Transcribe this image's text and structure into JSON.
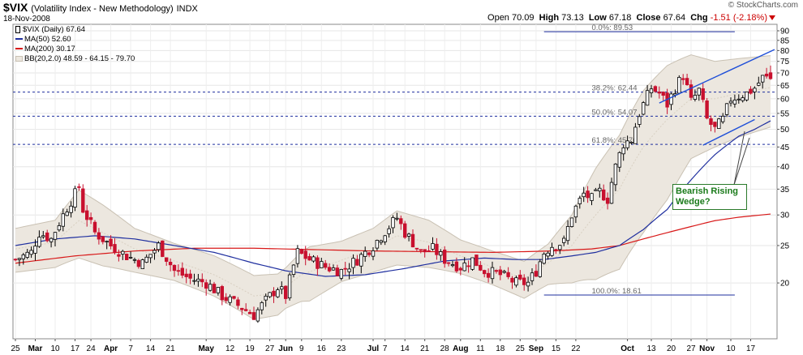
{
  "header": {
    "symbol": "$VIX",
    "description": "(Volatility Index - New Methodology)",
    "exchange": "INDX",
    "date": "18-Nov-2008",
    "credit": "© StockCharts.com",
    "open_label": "Open",
    "open": "70.09",
    "high_label": "High",
    "high": "73.13",
    "low_label": "Low",
    "low": "67.18",
    "close_label": "Close",
    "close": "67.64",
    "chg_label": "Chg",
    "chg": "-1.51 (-2.18%)"
  },
  "legend": {
    "price": "$VIX (Daily) 67.64",
    "ma50": "MA(50) 52.60",
    "ma200": "MA(200) 30.17",
    "bb": "BB(20,2.0) 48.59 - 64.15 - 79.70"
  },
  "annotation": {
    "line1": "Bearish Rising",
    "line2": "Wedge?"
  },
  "colors": {
    "up": "#ffffff",
    "down": "#c8102e",
    "ma50": "#1f2f9f",
    "ma200": "#d81818",
    "bb_fill": "#ece7df",
    "bb_line": "#c9c1b3",
    "fib": "#1f2f9f",
    "wedge": "#1f4fd8"
  },
  "chart_data": {
    "type": "candlestick",
    "scale": "log",
    "ylim": [
      14,
      92
    ],
    "y_ticks": [
      20,
      25,
      30,
      35,
      40,
      45,
      50,
      55,
      60,
      65,
      70,
      75,
      80,
      85,
      90
    ],
    "x_ticks": [
      {
        "i": 0,
        "label": "25"
      },
      {
        "i": 5,
        "label": "Mar"
      },
      {
        "i": 10,
        "label": "10"
      },
      {
        "i": 15,
        "label": "17"
      },
      {
        "i": 19,
        "label": "24"
      },
      {
        "i": 24,
        "label": "Apr"
      },
      {
        "i": 29,
        "label": "7"
      },
      {
        "i": 34,
        "label": "14"
      },
      {
        "i": 39,
        "label": "21"
      },
      {
        "i": 48,
        "label": "May"
      },
      {
        "i": 54,
        "label": "12"
      },
      {
        "i": 59,
        "label": "19"
      },
      {
        "i": 64,
        "label": "27"
      },
      {
        "i": 68,
        "label": "Jun"
      },
      {
        "i": 72,
        "label": "9"
      },
      {
        "i": 77,
        "label": "16"
      },
      {
        "i": 82,
        "label": "23"
      },
      {
        "i": 90,
        "label": "Jul"
      },
      {
        "i": 93,
        "label": "7"
      },
      {
        "i": 98,
        "label": "14"
      },
      {
        "i": 103,
        "label": "21"
      },
      {
        "i": 108,
        "label": "28"
      },
      {
        "i": 112,
        "label": "Aug"
      },
      {
        "i": 117,
        "label": "11"
      },
      {
        "i": 122,
        "label": "18"
      },
      {
        "i": 127,
        "label": "25"
      },
      {
        "i": 131,
        "label": "Sep"
      },
      {
        "i": 136,
        "label": "15"
      },
      {
        "i": 141,
        "label": "22"
      },
      {
        "i": 154,
        "label": "Oct"
      },
      {
        "i": 160,
        "label": "13"
      },
      {
        "i": 165,
        "label": "20"
      },
      {
        "i": 170,
        "label": "27"
      },
      {
        "i": 174,
        "label": "Nov"
      },
      {
        "i": 180,
        "label": "10"
      },
      {
        "i": 185,
        "label": "17"
      }
    ],
    "fib_levels": [
      {
        "label": "0.0%: 89.53",
        "value": 89.53
      },
      {
        "label": "38.2%: 62.44",
        "value": 62.44
      },
      {
        "label": "50.0%: 54.07",
        "value": 54.07
      },
      {
        "label": "61.8%: 45.70",
        "value": 45.7
      },
      {
        "label": "100.0%: 18.61",
        "value": 18.61
      }
    ],
    "wedge_lines": [
      {
        "from": [
          162,
          58.5
        ],
        "to": [
          191,
          80.5
        ]
      },
      {
        "from": [
          173,
          45.5
        ],
        "to": [
          186,
          53.0
        ]
      }
    ],
    "ohlc_path": [
      [
        0,
        23
      ],
      [
        4,
        24
      ],
      [
        6,
        27
      ],
      [
        9,
        26
      ],
      [
        12,
        30
      ],
      [
        15,
        34
      ],
      [
        16,
        35.5
      ],
      [
        17,
        31
      ],
      [
        20,
        27
      ],
      [
        24,
        25
      ],
      [
        28,
        23.5
      ],
      [
        32,
        22.5
      ],
      [
        36,
        25
      ],
      [
        40,
        21.5
      ],
      [
        44,
        20.5
      ],
      [
        48,
        20
      ],
      [
        52,
        18.5
      ],
      [
        56,
        17.5
      ],
      [
        60,
        16.5
      ],
      [
        62,
        17.5
      ],
      [
        66,
        19.5
      ],
      [
        68,
        18.5
      ],
      [
        71,
        24
      ],
      [
        74,
        23
      ],
      [
        78,
        22
      ],
      [
        82,
        21.5
      ],
      [
        86,
        23
      ],
      [
        90,
        25
      ],
      [
        94,
        28
      ],
      [
        96,
        29.5
      ],
      [
        98,
        27
      ],
      [
        102,
        24
      ],
      [
        105,
        24.5
      ],
      [
        108,
        23
      ],
      [
        112,
        22
      ],
      [
        115,
        23
      ],
      [
        118,
        21.5
      ],
      [
        122,
        21
      ],
      [
        126,
        20
      ],
      [
        129,
        20
      ],
      [
        131,
        21.5
      ],
      [
        133,
        24
      ],
      [
        135,
        25
      ],
      [
        138,
        25.5
      ],
      [
        140,
        30
      ],
      [
        143,
        34
      ],
      [
        145,
        33
      ],
      [
        147,
        34.5
      ],
      [
        149,
        33
      ],
      [
        151,
        40
      ],
      [
        153,
        46
      ],
      [
        155,
        47
      ],
      [
        157,
        55
      ],
      [
        160,
        64
      ],
      [
        162,
        62
      ],
      [
        164,
        58
      ],
      [
        166,
        64
      ],
      [
        168,
        69
      ],
      [
        170,
        59
      ],
      [
        172,
        63
      ],
      [
        174,
        53
      ],
      [
        176,
        50
      ],
      [
        178,
        53
      ],
      [
        180,
        60
      ],
      [
        182,
        61
      ],
      [
        184,
        62
      ],
      [
        186,
        64
      ],
      [
        188,
        68
      ],
      [
        190,
        67.64
      ]
    ],
    "ma50_path": [
      [
        0,
        25
      ],
      [
        10,
        26
      ],
      [
        20,
        26.5
      ],
      [
        30,
        26
      ],
      [
        40,
        25
      ],
      [
        50,
        24
      ],
      [
        60,
        22.5
      ],
      [
        68,
        21.5
      ],
      [
        78,
        20.8
      ],
      [
        88,
        21
      ],
      [
        98,
        21.8
      ],
      [
        108,
        22.8
      ],
      [
        118,
        23.2
      ],
      [
        126,
        23
      ],
      [
        133,
        23
      ],
      [
        140,
        23.5
      ],
      [
        146,
        24
      ],
      [
        152,
        25
      ],
      [
        158,
        27.5
      ],
      [
        164,
        31
      ],
      [
        170,
        37
      ],
      [
        176,
        43
      ],
      [
        182,
        48
      ],
      [
        186,
        50
      ],
      [
        190,
        52.6
      ]
    ],
    "ma200_path": [
      [
        0,
        22.5
      ],
      [
        15,
        23.5
      ],
      [
        30,
        24.2
      ],
      [
        45,
        24.6
      ],
      [
        60,
        24.6
      ],
      [
        75,
        24.4
      ],
      [
        90,
        24.2
      ],
      [
        105,
        24.1
      ],
      [
        120,
        24
      ],
      [
        135,
        24.2
      ],
      [
        145,
        24.5
      ],
      [
        152,
        25
      ],
      [
        158,
        26
      ],
      [
        164,
        27
      ],
      [
        170,
        28
      ],
      [
        176,
        29
      ],
      [
        182,
        29.6
      ],
      [
        190,
        30.17
      ]
    ],
    "bb_mid_path": [
      [
        0,
        24.5
      ],
      [
        10,
        25.5
      ],
      [
        16,
        29
      ],
      [
        22,
        27
      ],
      [
        30,
        24.5
      ],
      [
        40,
        22.8
      ],
      [
        50,
        21
      ],
      [
        60,
        18.5
      ],
      [
        66,
        18.8
      ],
      [
        72,
        21
      ],
      [
        80,
        22.5
      ],
      [
        90,
        24.5
      ],
      [
        96,
        26.5
      ],
      [
        104,
        25.5
      ],
      [
        112,
        23.5
      ],
      [
        120,
        22
      ],
      [
        128,
        20.5
      ],
      [
        134,
        22.5
      ],
      [
        140,
        25
      ],
      [
        146,
        30
      ],
      [
        152,
        35
      ],
      [
        158,
        45
      ],
      [
        164,
        53
      ],
      [
        170,
        60
      ],
      [
        176,
        60
      ],
      [
        182,
        62
      ],
      [
        190,
        64.15
      ]
    ],
    "bb_width_path": [
      [
        0,
        0.13
      ],
      [
        10,
        0.14
      ],
      [
        16,
        0.2
      ],
      [
        22,
        0.18
      ],
      [
        30,
        0.13
      ],
      [
        40,
        0.11
      ],
      [
        50,
        0.12
      ],
      [
        60,
        0.13
      ],
      [
        68,
        0.12
      ],
      [
        74,
        0.16
      ],
      [
        82,
        0.12
      ],
      [
        90,
        0.13
      ],
      [
        96,
        0.16
      ],
      [
        104,
        0.14
      ],
      [
        112,
        0.1
      ],
      [
        120,
        0.1
      ],
      [
        128,
        0.11
      ],
      [
        134,
        0.12
      ],
      [
        140,
        0.2
      ],
      [
        146,
        0.32
      ],
      [
        152,
        0.38
      ],
      [
        158,
        0.4
      ],
      [
        164,
        0.38
      ],
      [
        170,
        0.3
      ],
      [
        176,
        0.25
      ],
      [
        182,
        0.23
      ],
      [
        190,
        0.21
      ]
    ]
  }
}
